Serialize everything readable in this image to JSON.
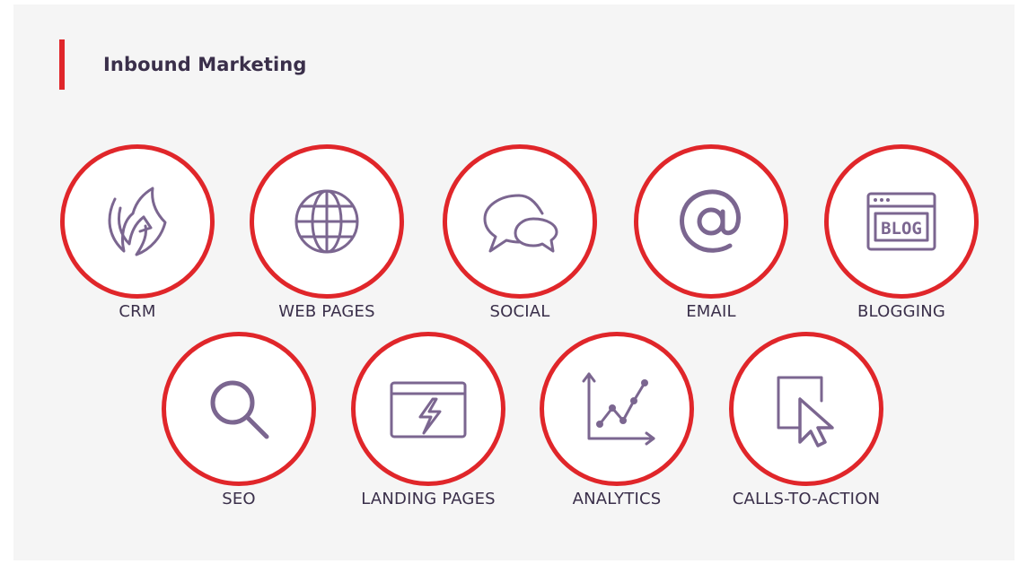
{
  "heading": "Inbound Marketing",
  "colors": {
    "accent": "#e0262a",
    "icon": "#7b6690",
    "text": "#3a2f4a",
    "panel": "#f5f5f5"
  },
  "items": [
    {
      "label": "CRM",
      "icon": "crm-sprocket-icon"
    },
    {
      "label": "WEB PAGES",
      "icon": "globe-icon"
    },
    {
      "label": "SOCIAL",
      "icon": "chat-bubbles-icon"
    },
    {
      "label": "EMAIL",
      "icon": "at-sign-icon"
    },
    {
      "label": "BLOGGING",
      "icon": "blog-window-icon"
    },
    {
      "label": "SEO",
      "icon": "search-icon"
    },
    {
      "label": "LANDING PAGES",
      "icon": "lightning-window-icon"
    },
    {
      "label": "ANALYTICS",
      "icon": "line-chart-icon"
    },
    {
      "label": "CALLS-TO-ACTION",
      "icon": "cursor-click-icon"
    }
  ],
  "blog_icon_text": "BLOG"
}
